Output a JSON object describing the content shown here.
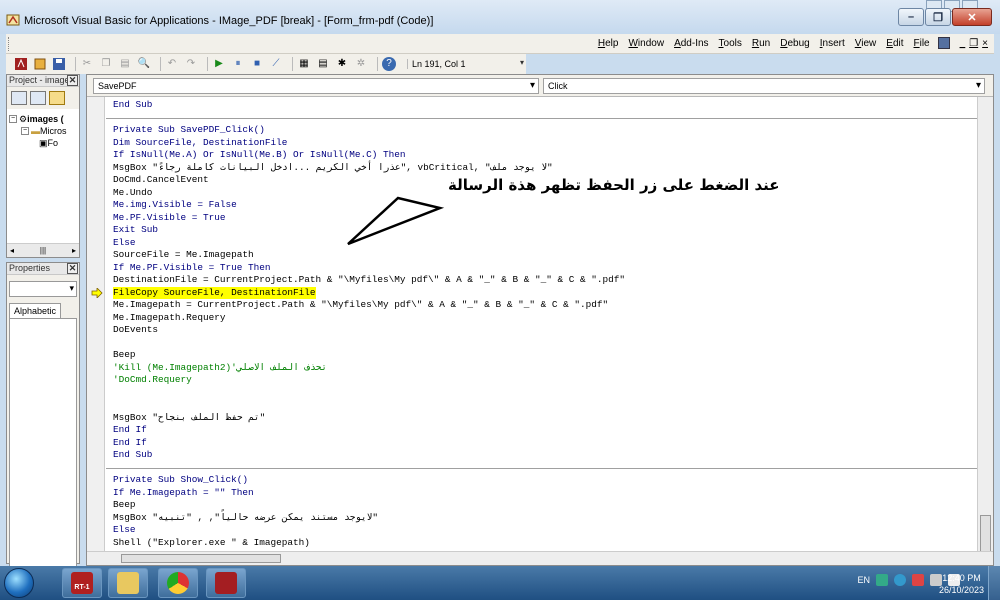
{
  "window": {
    "title": "Microsoft Visual Basic for Applications - IMage_PDF [break] - [Form_frm-pdf (Code)]",
    "minimize_glyph": "–",
    "restore_glyph": "❐",
    "close_glyph": "✕"
  },
  "menu": {
    "items": [
      "Help",
      "Window",
      "Add-Ins",
      "Tools",
      "Run",
      "Debug",
      "Insert",
      "View",
      "Edit",
      "File"
    ],
    "mdi_min": "_",
    "mdi_restore": "❐",
    "mdi_close": "×"
  },
  "toolbar": {
    "position": "Ln 191, Col 1"
  },
  "project_panel": {
    "title": "Project - images",
    "close_glyph": "✕",
    "tree": [
      "images (",
      "Micros",
      "Fo"
    ],
    "scroll_left": "◂",
    "scroll_thumb": "|||",
    "scroll_right": "▸"
  },
  "properties_panel": {
    "title": "Properties",
    "close_glyph": "✕",
    "tab": "Alphabetic"
  },
  "code_window": {
    "object_combo": "SavePDF",
    "procedure_combo": "Click",
    "lines": [
      {
        "text": "End Sub",
        "type": "keyword"
      },
      {
        "text": "",
        "type": "plain"
      },
      {
        "text": "Private Sub SavePDF_Click()",
        "type": "keyword"
      },
      {
        "text": "Dim SourceFile, DestinationFile",
        "type": "keyword"
      },
      {
        "text": "If IsNull(Me.A) Or IsNull(Me.B) Or IsNull(Me.C) Then",
        "type": "keyword"
      },
      {
        "text": "MsgBox \"عذرا أخي الكريم ...ادخل البيانات كاملة رجاءً\", vbCritical, \"لا يوجد ملف\"",
        "type": "plain"
      },
      {
        "text": "DoCmd.CancelEvent",
        "type": "plain"
      },
      {
        "text": "Me.Undo",
        "type": "plain"
      },
      {
        "text": "Me.img.Visible = False",
        "type": "keyword"
      },
      {
        "text": "Me.PF.Visible = True",
        "type": "keyword"
      },
      {
        "text": "Exit Sub",
        "type": "keyword"
      },
      {
        "text": "Else",
        "type": "keyword"
      },
      {
        "text": "SourceFile = Me.Imagepath",
        "type": "plain"
      },
      {
        "text": "If Me.PF.Visible = True Then",
        "type": "keyword"
      },
      {
        "text": "DestinationFile = CurrentProject.Path & \"\\Myfiles\\My pdf\\\" & A & \"_\" & B & \"_\" & C & \".pdf\"",
        "type": "plain"
      },
      {
        "text": "FileCopy SourceFile, DestinationFile",
        "type": "highlight"
      },
      {
        "text": "Me.Imagepath = CurrentProject.Path & \"\\Myfiles\\My pdf\\\" & A & \"_\" & B & \"_\" & C & \".pdf\"",
        "type": "plain"
      },
      {
        "text": "Me.Imagepath.Requery",
        "type": "plain"
      },
      {
        "text": "DoEvents",
        "type": "plain"
      },
      {
        "text": "",
        "type": "plain"
      },
      {
        "text": "Beep",
        "type": "plain"
      },
      {
        "text": "'Kill (Me.Imagepath2)'تحذف الملف الاصلي",
        "type": "comment"
      },
      {
        "text": "'DoCmd.Requery",
        "type": "comment"
      },
      {
        "text": "",
        "type": "plain"
      },
      {
        "text": "",
        "type": "plain"
      },
      {
        "text": "MsgBox \"تم حفظ الملف بنجاح\"",
        "type": "plain"
      },
      {
        "text": "End If",
        "type": "keyword"
      },
      {
        "text": "End If",
        "type": "keyword"
      },
      {
        "text": "End Sub",
        "type": "keyword"
      },
      {
        "text": "",
        "type": "plain"
      },
      {
        "text": "Private Sub Show_Click()",
        "type": "keyword"
      },
      {
        "text": "If Me.Imagepath = \"\" Then",
        "type": "keyword"
      },
      {
        "text": "Beep",
        "type": "plain"
      },
      {
        "text": "MsgBox \"لايوجد مستند يمكن عرضه حالياً\", , \"تنبيه\"",
        "type": "plain"
      },
      {
        "text": "Else",
        "type": "keyword"
      },
      {
        "text": "Shell (\"Explorer.exe \" & Imagepath)",
        "type": "plain"
      }
    ],
    "scroll_glyph": "|||"
  },
  "annotation": {
    "text": "عند الضغط على زر الحفظ تظهر هذة الرسالة"
  },
  "taskbar": {
    "rt_label": "RT-1",
    "language": "EN",
    "time": "12:40 PM",
    "date": "26/10/2023"
  },
  "colors": {
    "keyword": "#000080",
    "comment": "#008000",
    "highlight": "#ffff00"
  }
}
